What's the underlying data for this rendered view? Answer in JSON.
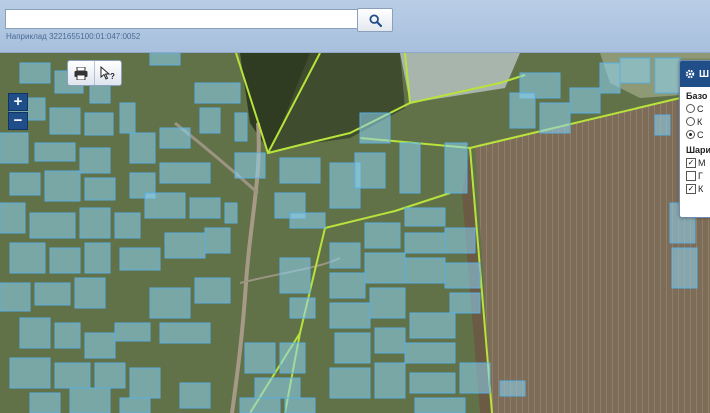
{
  "search": {
    "value": "",
    "placeholder": "",
    "hint": "Наприклад 3221655100:01:047:0052"
  },
  "zoom": {
    "in_label": "+",
    "out_label": "−"
  },
  "layers_panel": {
    "title": "Ш",
    "base_section": "Базо",
    "base_options": [
      {
        "label": "С",
        "selected": false
      },
      {
        "label": "К",
        "selected": false
      },
      {
        "label": "С",
        "selected": true
      }
    ],
    "layers_section": "Шари",
    "layer_options": [
      {
        "label": "М",
        "checked": true
      },
      {
        "label": "Г",
        "checked": false
      },
      {
        "label": "К",
        "checked": true
      }
    ]
  },
  "icons": {
    "search": "search-icon",
    "print": "print-icon",
    "identify": "identify-cursor-icon",
    "settings": "gear-icon"
  },
  "colors": {
    "parcel_fill": "#8ed3f2",
    "parcel_stroke": "#5aaee0",
    "boundary_line": "#b7e33c",
    "panel_header": "#1f4e89"
  }
}
